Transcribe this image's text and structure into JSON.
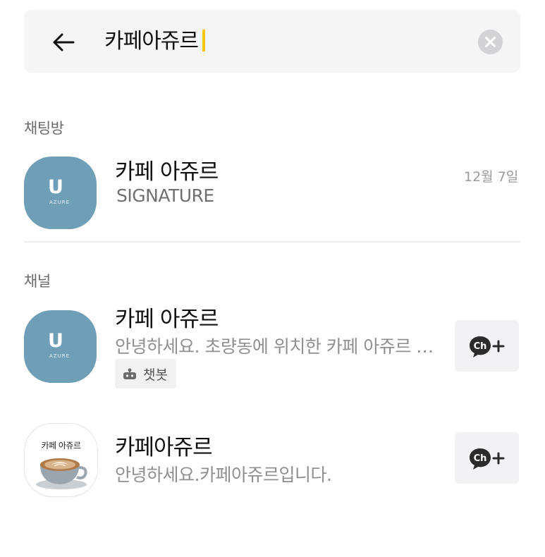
{
  "search": {
    "query": "카페아쥬르"
  },
  "sections": {
    "chatrooms_label": "채팅방",
    "channels_label": "채널"
  },
  "chatrooms": [
    {
      "title": "카페 아쥬르",
      "subtitle": "SIGNATURE",
      "date": "12월 7일",
      "avatar_color": "#6f9fb7",
      "avatar_logo": "U",
      "avatar_logo_sub": "AZURE"
    }
  ],
  "channels": [
    {
      "title": "카페 아쥬르",
      "subtitle": "안녕하세요. 초량동에 위치한 카페 아쥬르 …",
      "badge": "챗봇",
      "avatar_color": "#6f9fb7",
      "avatar_logo": "U",
      "avatar_logo_sub": "AZURE",
      "add_button_icon": "ch-add-icon"
    },
    {
      "title": "카페아쥬르",
      "subtitle": "안녕하세요.카페아쥬르입니다.",
      "avatar_label": "카페 아쥬르",
      "add_button_icon": "ch-add-icon"
    }
  ],
  "colors": {
    "caret": "#f5c800",
    "search_bg": "#f5f5f6",
    "avatar_blue": "#6f9fb7"
  }
}
